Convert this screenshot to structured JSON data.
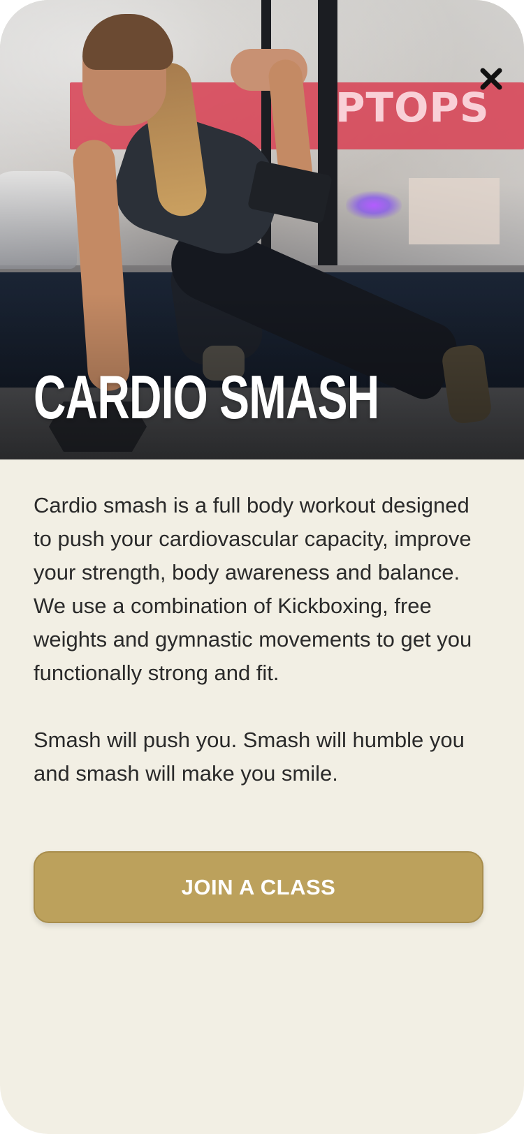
{
  "workout": {
    "title": "CARDIO SMASH",
    "description": [
      "Cardio smash is a full body workout designed to push your cardiovascular capacity, improve your strength, body awareness and balance. We use a combination of Kickboxing, free weights and gymnastic movements to get you functionally strong and fit.",
      "Smash will push you. Smash will humble you and smash will make you smile."
    ]
  },
  "hero": {
    "image": "woman-renegade-row-dumbbells-photo",
    "background_sign_text": "PTOPS"
  },
  "actions": {
    "close_icon": "close-icon",
    "join_label": "JOIN A CLASS"
  },
  "colors": {
    "background": "#f2efe4",
    "accent": "#bca15c",
    "text": "#2a2a2a",
    "title": "#ffffff"
  }
}
